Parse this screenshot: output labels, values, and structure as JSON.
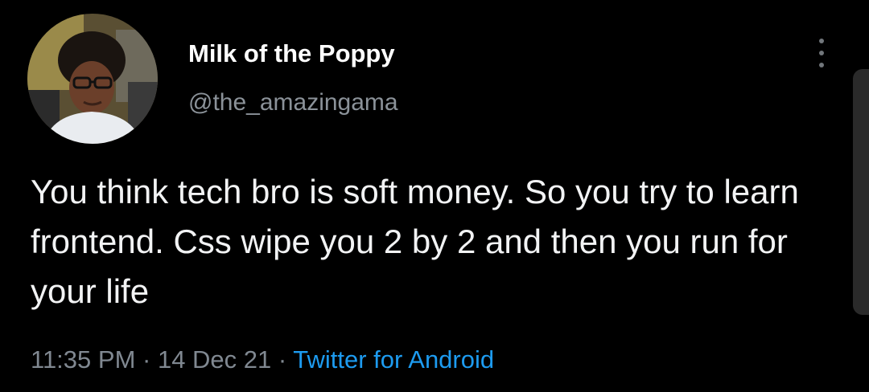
{
  "tweet": {
    "display_name": "Milk of the Poppy",
    "handle": "@the_amazingama",
    "text": "You think tech bro is soft money. So you try to learn frontend. Css wipe you 2 by 2 and then you run for your life",
    "time": "11:35 PM",
    "separator": " · ",
    "date": "14 Dec 21",
    "source": "Twitter for Android"
  },
  "icons": {
    "more": "more-vertical-icon",
    "avatar": "profile-photo"
  },
  "colors": {
    "background": "#000000",
    "text": "#f2f3f4",
    "muted": "#808891",
    "link": "#1d9bf0"
  }
}
